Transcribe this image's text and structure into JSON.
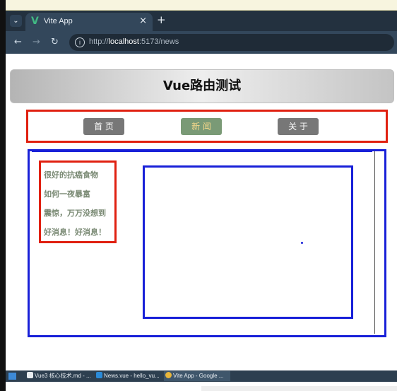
{
  "browser": {
    "tab_title": "Vite App",
    "new_tab_symbol": "+",
    "close_symbol": "×",
    "url_prefix": "http://",
    "url_host": "localhost",
    "url_path": ":5173/news"
  },
  "page": {
    "title": "Vue路由测试",
    "nav": [
      {
        "label": "首 页",
        "active": false
      },
      {
        "label": "新 闻",
        "active": true
      },
      {
        "label": "关 于",
        "active": false
      }
    ],
    "news_list": [
      "很好的抗癌食物",
      "如何一夜暴富",
      "震惊，万万没想到",
      "好消息！好消息！"
    ]
  },
  "taskbar": {
    "items": [
      "Vue3 核心技术.md - ...",
      "News.vue - hello_vu...",
      "Vite App - Google ..."
    ]
  },
  "colors": {
    "red_border": "#e02010",
    "blue_border": "#1820d8",
    "nav_button": "#777777",
    "nav_active": "#7a9a76",
    "nav_active_text": "#f5d88b"
  }
}
